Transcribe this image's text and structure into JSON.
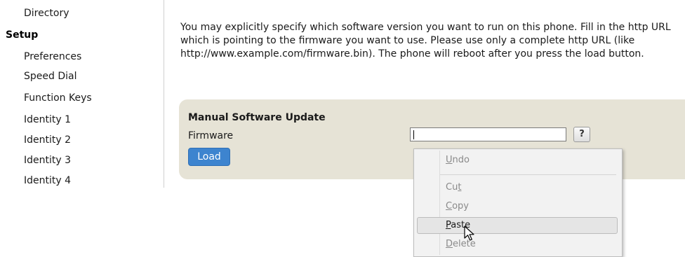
{
  "sidebar": {
    "directory": "Directory",
    "setup_heading": "Setup",
    "items": [
      "Preferences",
      "Speed Dial",
      "Function Keys",
      "Identity 1",
      "Identity 2",
      "Identity 3",
      "Identity 4"
    ]
  },
  "intro_text": "You may explicitly specify which software version you want to run on this phone. Fill in the http URL which is pointing to the firmware you want to use. Please use only a complete http URL (like http://www.example.com/firmware.bin). The phone will reboot after you press the load button.",
  "update": {
    "title": "Manual Software Update",
    "firmware_label": "Firmware",
    "firmware_value": "",
    "help_label": "?",
    "load_label": "Load"
  },
  "context_menu": {
    "items": [
      {
        "label": "Undo",
        "accel": "U",
        "state": "disabled"
      },
      {
        "label": "Cut",
        "accel": "t",
        "state": "disabled"
      },
      {
        "label": "Copy",
        "accel": "C",
        "state": "disabled"
      },
      {
        "label": "Paste",
        "accel": "P",
        "state": "hover"
      },
      {
        "label": "Delete",
        "accel": "D",
        "state": "disabled"
      }
    ]
  },
  "icons": {
    "cursor": "mouse-pointer-icon",
    "help": "help-question-icon"
  }
}
